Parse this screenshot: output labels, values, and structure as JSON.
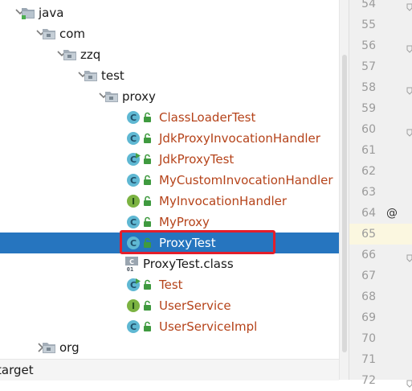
{
  "project_tree": {
    "nodes": [
      {
        "label": "java",
        "kind": "src-folder",
        "icon": "source-folder-icon",
        "expanded": true,
        "depth": 0
      },
      {
        "label": "com",
        "kind": "package",
        "icon": "package-folder-icon",
        "expanded": true,
        "depth": 1
      },
      {
        "label": "zzq",
        "kind": "package",
        "icon": "package-folder-icon",
        "expanded": true,
        "depth": 2
      },
      {
        "label": "test",
        "kind": "package",
        "icon": "package-folder-icon",
        "expanded": true,
        "depth": 3
      },
      {
        "label": "proxy",
        "kind": "package",
        "icon": "package-folder-icon",
        "expanded": true,
        "depth": 4
      },
      {
        "label": "ClassLoaderTest",
        "kind": "class",
        "icon": "class-icon",
        "depth": 5
      },
      {
        "label": "JdkProxyInvocationHandler",
        "kind": "class",
        "icon": "class-icon",
        "depth": 5
      },
      {
        "label": "JdkProxyTest",
        "kind": "class-runnable",
        "icon": "runnable-class-icon",
        "depth": 5
      },
      {
        "label": "MyCustomInvocationHandler",
        "kind": "class",
        "icon": "class-icon",
        "depth": 5
      },
      {
        "label": "MyInvocationHandler",
        "kind": "interface",
        "icon": "interface-icon",
        "depth": 5
      },
      {
        "label": "MyProxy",
        "kind": "class",
        "icon": "class-icon",
        "depth": 5
      },
      {
        "label": "ProxyTest",
        "kind": "class",
        "icon": "class-icon",
        "depth": 5,
        "selected": true
      },
      {
        "label": "ProxyTest.class",
        "kind": "binary",
        "icon": "class-file-icon",
        "depth": 4
      },
      {
        "label": "Test",
        "kind": "class-runnable",
        "icon": "runnable-class-icon",
        "depth": 5
      },
      {
        "label": "UserService",
        "kind": "interface",
        "icon": "interface-icon",
        "depth": 5
      },
      {
        "label": "UserServiceImpl",
        "kind": "class",
        "icon": "class-icon",
        "depth": 5
      },
      {
        "label": "org",
        "kind": "package",
        "icon": "package-folder-icon",
        "expanded": false,
        "depth": 1
      }
    ],
    "footer": {
      "label": "target"
    }
  },
  "editor_gutter": {
    "line_numbers": [
      "54",
      "55",
      "56",
      "57",
      "58",
      "59",
      "60",
      "61",
      "62",
      "63",
      "64",
      "65",
      "66",
      "67",
      "68",
      "69",
      "70",
      "71",
      "72"
    ],
    "current_line": "65",
    "annotation_line": "64",
    "annotation_marker": "@",
    "fold_lines": [
      "54",
      "56",
      "58",
      "60",
      "66",
      "72"
    ]
  },
  "colors": {
    "selection": "#2675bf",
    "class_icon": "#5fb8d3",
    "interface_icon": "#7cb342",
    "lock_green": "#3f9a3f",
    "highlight_box": "#e31e2b",
    "class_text": "#b5431a"
  }
}
